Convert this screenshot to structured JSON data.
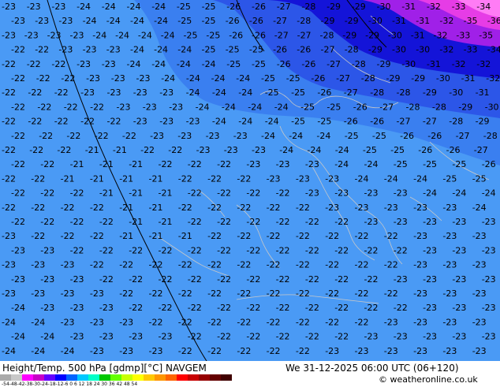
{
  "title_left": "Height/Temp. 500 hPa [gdmp][°C] NAVGEM",
  "title_right": "We 31-12-2025 06:00 UTC (06+120)",
  "credit": "© weatheronline.co.uk",
  "scale_labels": "-54-48-42-38-30-24-18-12-6  0  6  12  18  24  30  36  42  48  54",
  "colors": {
    "band_m22": "#4a9af5",
    "band_m26": "#3a7ff0",
    "band_m28": "#2c56e8",
    "band_m30": "#1414d8",
    "band_m32": "#a020e8",
    "band_m34": "#e63ce6",
    "band_m36": "#ff7cf5",
    "contour": "#000000",
    "coast": "#c8c8c8",
    "isotherm_text": "#000000"
  },
  "temperature_labels": [
    {
      "row": 0,
      "values": [
        "-23",
        "-23",
        "-23",
        "-24",
        "-24",
        "-24",
        "-24",
        "-25",
        "-25",
        "-26",
        "-26",
        "-27",
        "-28",
        "-29",
        "-29",
        "-30",
        "-31",
        "-32",
        "-33",
        "-34"
      ]
    },
    {
      "row": 1,
      "values": [
        "-23",
        "-23",
        "-23",
        "-24",
        "-24",
        "-24",
        "-24",
        "-25",
        "-25",
        "-26",
        "-26",
        "-27",
        "-28",
        "-29",
        "-29",
        "-30",
        "-31",
        "-31",
        "-32",
        "-35",
        "-36"
      ]
    },
    {
      "row": 2,
      "values": [
        "-23",
        "-23",
        "-23",
        "-23",
        "-24",
        "-24",
        "-24",
        "-24",
        "-25",
        "-25",
        "-26",
        "-26",
        "-27",
        "-27",
        "-28",
        "-29",
        "-29",
        "-30",
        "-31",
        "-32",
        "-33",
        "-35"
      ]
    },
    {
      "row": 3,
      "values": [
        "-22",
        "-22",
        "-23",
        "-23",
        "-23",
        "-24",
        "-24",
        "-24",
        "-25",
        "-25",
        "-25",
        "-26",
        "-26",
        "-27",
        "-28",
        "-29",
        "-30",
        "-30",
        "-32",
        "-33",
        "-34"
      ]
    },
    {
      "row": 4,
      "values": [
        "-22",
        "-22",
        "-22",
        "-23",
        "-23",
        "-24",
        "-24",
        "-24",
        "-24",
        "-25",
        "-25",
        "-26",
        "-26",
        "-27",
        "-28",
        "-29",
        "-30",
        "-31",
        "-32",
        "-32"
      ]
    },
    {
      "row": 5,
      "values": [
        "-22",
        "-22",
        "-22",
        "-23",
        "-23",
        "-23",
        "-24",
        "-24",
        "-24",
        "-24",
        "-25",
        "-25",
        "-26",
        "-27",
        "-28",
        "-29",
        "-29",
        "-30",
        "-31",
        "-32"
      ]
    },
    {
      "row": 6,
      "values": [
        "-22",
        "-22",
        "-22",
        "-23",
        "-23",
        "-23",
        "-23",
        "-24",
        "-24",
        "-24",
        "-25",
        "-25",
        "-26",
        "-27",
        "-28",
        "-28",
        "-29",
        "-30",
        "-31"
      ]
    },
    {
      "row": 7,
      "values": [
        "-22",
        "-22",
        "-22",
        "-22",
        "-23",
        "-23",
        "-23",
        "-24",
        "-24",
        "-24",
        "-24",
        "-25",
        "-25",
        "-26",
        "-27",
        "-28",
        "-28",
        "-29",
        "-30"
      ]
    },
    {
      "row": 8,
      "values": [
        "-22",
        "-22",
        "-22",
        "-22",
        "-22",
        "-23",
        "-23",
        "-23",
        "-24",
        "-24",
        "-24",
        "-25",
        "-25",
        "-26",
        "-26",
        "-27",
        "-27",
        "-28",
        "-29"
      ]
    },
    {
      "row": 9,
      "values": [
        "-22",
        "-22",
        "-22",
        "-22",
        "-22",
        "-23",
        "-23",
        "-23",
        "-23",
        "-24",
        "-24",
        "-24",
        "-25",
        "-25",
        "-26",
        "-26",
        "-27",
        "-28"
      ]
    },
    {
      "row": 10,
      "values": [
        "-22",
        "-22",
        "-22",
        "-21",
        "-21",
        "-22",
        "-22",
        "-23",
        "-23",
        "-23",
        "-24",
        "-24",
        "-24",
        "-25",
        "-25",
        "-26",
        "-26",
        "-27"
      ]
    },
    {
      "row": 11,
      "values": [
        "-22",
        "-22",
        "-21",
        "-21",
        "-21",
        "-22",
        "-22",
        "-22",
        "-23",
        "-23",
        "-23",
        "-24",
        "-24",
        "-25",
        "-25",
        "-25",
        "-26"
      ]
    },
    {
      "row": 12,
      "values": [
        "-22",
        "-22",
        "-21",
        "-21",
        "-21",
        "-21",
        "-22",
        "-22",
        "-22",
        "-23",
        "-23",
        "-23",
        "-24",
        "-24",
        "-24",
        "-25",
        "-25"
      ]
    },
    {
      "row": 13,
      "values": [
        "-22",
        "-22",
        "-22",
        "-21",
        "-21",
        "-21",
        "-22",
        "-22",
        "-22",
        "-22",
        "-23",
        "-23",
        "-23",
        "-23",
        "-24",
        "-24",
        "-24"
      ]
    },
    {
      "row": 14,
      "values": [
        "-22",
        "-22",
        "-22",
        "-22",
        "-21",
        "-21",
        "-22",
        "-22",
        "-22",
        "-22",
        "-22",
        "-23",
        "-23",
        "-23",
        "-23",
        "-23",
        "-24"
      ]
    },
    {
      "row": 15,
      "values": [
        "-22",
        "-22",
        "-22",
        "-22",
        "-21",
        "-21",
        "-22",
        "-22",
        "-22",
        "-22",
        "-22",
        "-22",
        "-23",
        "-23",
        "-23",
        "-23",
        "-23"
      ]
    },
    {
      "row": 16,
      "values": [
        "-23",
        "-22",
        "-22",
        "-22",
        "-21",
        "-21",
        "-21",
        "-22",
        "-22",
        "-22",
        "-22",
        "-22",
        "-22",
        "-22",
        "-23",
        "-23",
        "-23"
      ]
    },
    {
      "row": 17,
      "values": [
        "-23",
        "-23",
        "-22",
        "-22",
        "-22",
        "-22",
        "-22",
        "-22",
        "-22",
        "-22",
        "-22",
        "-22",
        "-22",
        "-22",
        "-23",
        "-23",
        "-23"
      ]
    },
    {
      "row": 18,
      "values": [
        "-23",
        "-23",
        "-23",
        "-22",
        "-22",
        "-22",
        "-22",
        "-22",
        "-22",
        "-22",
        "-22",
        "-22",
        "-22",
        "-22",
        "-23",
        "-23",
        "-23"
      ]
    },
    {
      "row": 19,
      "values": [
        "-23",
        "-23",
        "-23",
        "-22",
        "-22",
        "-22",
        "-22",
        "-22",
        "-22",
        "-22",
        "-22",
        "-22",
        "-22",
        "-23",
        "-23",
        "-23",
        "-23"
      ]
    },
    {
      "row": 20,
      "values": [
        "-23",
        "-23",
        "-23",
        "-23",
        "-22",
        "-22",
        "-22",
        "-22",
        "-22",
        "-22",
        "-22",
        "-22",
        "-22",
        "-22",
        "-23",
        "-23",
        "-23"
      ]
    },
    {
      "row": 21,
      "values": [
        "-24",
        "-23",
        "-23",
        "-23",
        "-22",
        "-22",
        "-22",
        "-22",
        "-22",
        "-22",
        "-22",
        "-22",
        "-22",
        "-22",
        "-23",
        "-23",
        "-23"
      ]
    },
    {
      "row": 22,
      "values": [
        "-24",
        "-24",
        "-23",
        "-23",
        "-23",
        "-22",
        "-22",
        "-22",
        "-22",
        "-22",
        "-22",
        "-22",
        "-22",
        "-23",
        "-23",
        "-23",
        "-23"
      ]
    },
    {
      "row": 23,
      "values": [
        "-24",
        "-24",
        "-23",
        "-23",
        "-23",
        "-23",
        "-22",
        "-22",
        "-22",
        "-22",
        "-22",
        "-22",
        "-23",
        "-23",
        "-23",
        "-23",
        "-23"
      ]
    },
    {
      "row": 24,
      "values": [
        "-24",
        "-24",
        "-24",
        "-23",
        "-23",
        "-23",
        "-22",
        "-22",
        "-22",
        "-22",
        "-22",
        "-23",
        "-23",
        "-23",
        "-23",
        "-23",
        "-23"
      ]
    }
  ]
}
